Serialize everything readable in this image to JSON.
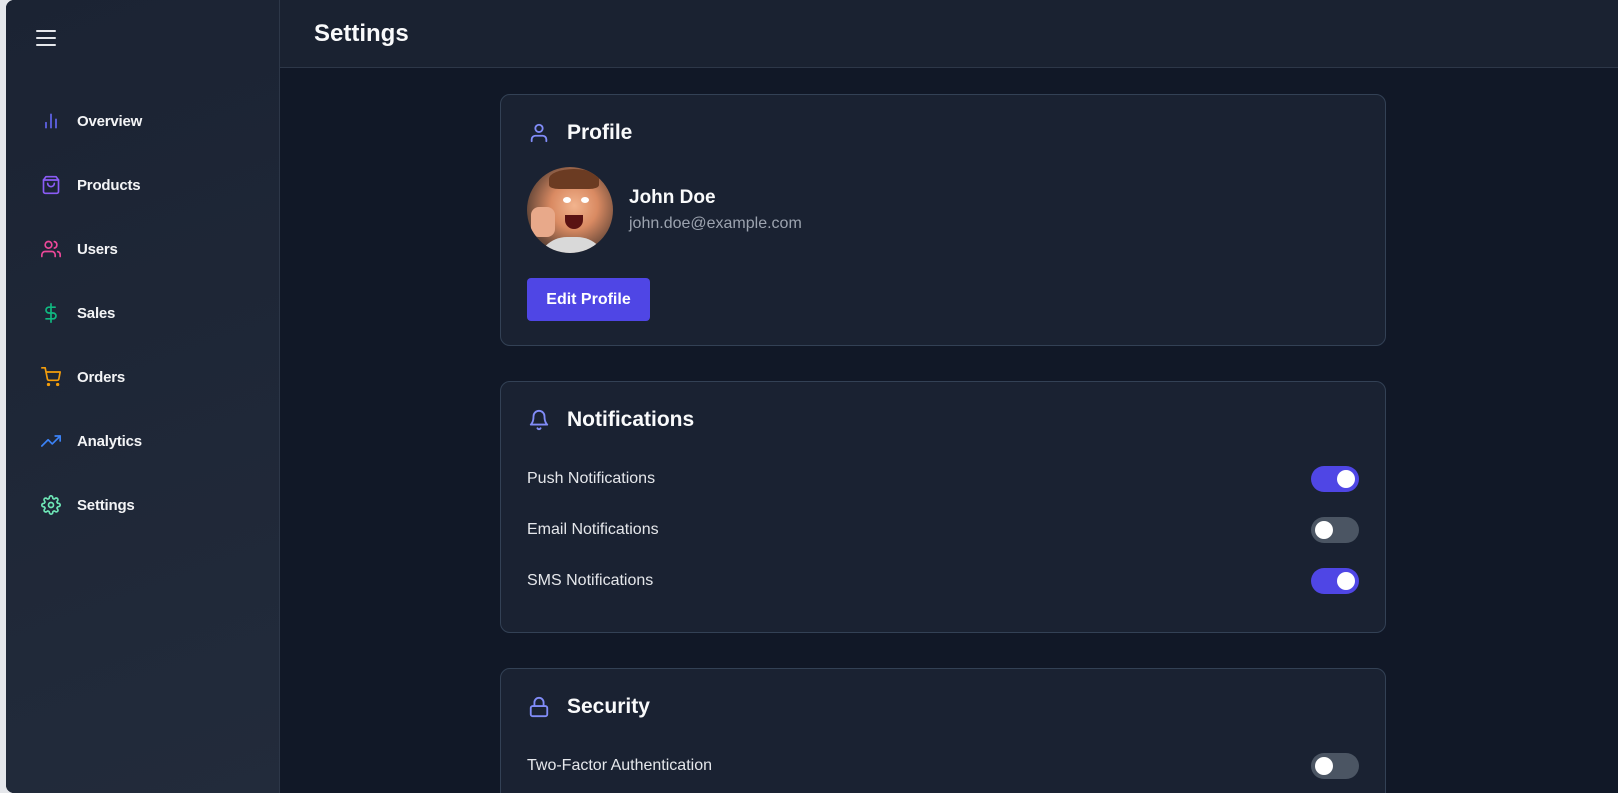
{
  "sidebar": {
    "items": [
      {
        "label": "Overview",
        "icon": "bar-chart-icon",
        "color": "#6366f1"
      },
      {
        "label": "Products",
        "icon": "shopping-bag-icon",
        "color": "#8b5cf6"
      },
      {
        "label": "Users",
        "icon": "users-icon",
        "color": "#ec4899"
      },
      {
        "label": "Sales",
        "icon": "dollar-sign-icon",
        "color": "#10b981"
      },
      {
        "label": "Orders",
        "icon": "shopping-cart-icon",
        "color": "#f59e0b"
      },
      {
        "label": "Analytics",
        "icon": "trending-up-icon",
        "color": "#3b82f6"
      },
      {
        "label": "Settings",
        "icon": "gear-icon",
        "color": "#6ee7b7"
      }
    ]
  },
  "header": {
    "title": "Settings"
  },
  "profile": {
    "heading": "Profile",
    "name": "John Doe",
    "email": "john.doe@example.com",
    "edit_label": "Edit Profile"
  },
  "notifications": {
    "heading": "Notifications",
    "items": [
      {
        "label": "Push Notifications",
        "enabled": true
      },
      {
        "label": "Email Notifications",
        "enabled": false
      },
      {
        "label": "SMS Notifications",
        "enabled": true
      }
    ]
  },
  "security": {
    "heading": "Security",
    "items": [
      {
        "label": "Two-Factor Authentication",
        "enabled": false
      }
    ]
  },
  "colors": {
    "accent": "#4f46e5",
    "icon_accent": "#818cf8"
  }
}
